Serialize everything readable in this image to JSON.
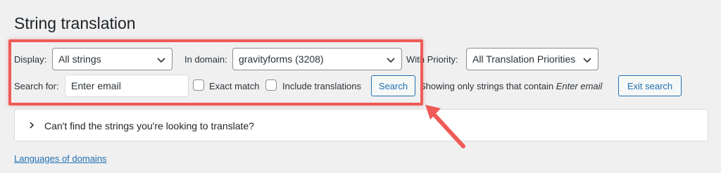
{
  "page": {
    "title": "String translation"
  },
  "filters": {
    "display_label": "Display:",
    "display_value": "All strings",
    "domain_label": "In domain:",
    "domain_value": "gravityforms (3208)",
    "priority_label": "With Priority:",
    "priority_value": "All Translation Priorities",
    "search_label": "Search for:",
    "search_placeholder": "Enter email",
    "exact_match_label": "Exact match",
    "include_translations_label": "Include translations",
    "search_button": "Search",
    "showing_prefix": "Showing only strings that contain",
    "showing_term": "Enter email",
    "exit_search_button": "Exit search"
  },
  "help_panel": {
    "text": "Can't find the strings you're looking to translate?"
  },
  "footer": {
    "languages_link": "Languages of domains"
  },
  "colors": {
    "accent": "#2271b1",
    "annotation": "#ef5b57",
    "background": "#f0f0f1"
  }
}
